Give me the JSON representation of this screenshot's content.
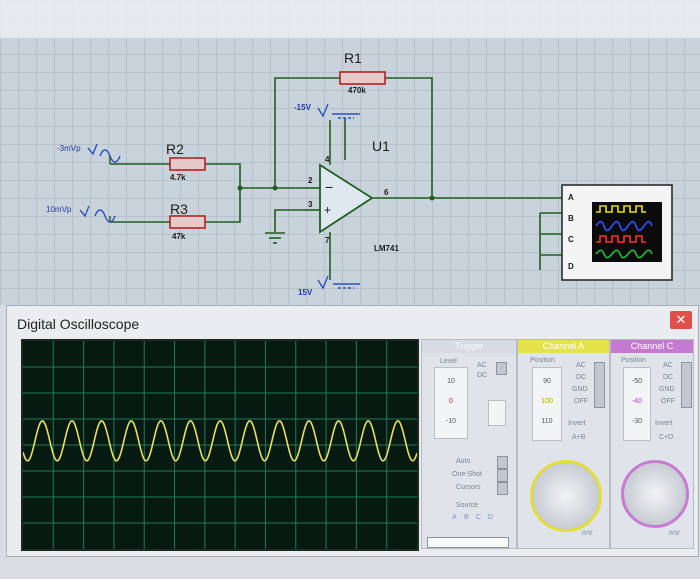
{
  "schematic": {
    "r1": {
      "name": "R1",
      "value": "470k"
    },
    "r2": {
      "name": "R2",
      "value": "4.7k"
    },
    "r3": {
      "name": "R3",
      "value": "47k"
    },
    "u1": {
      "name": "U1",
      "part": "LM741"
    },
    "sources": {
      "s1": "-3mVp",
      "s2": "10mVp"
    },
    "supplies": {
      "neg": "-15V",
      "pos": "15V"
    },
    "pins": {
      "p2": "2",
      "p3": "3",
      "p4": "4",
      "p6": "6",
      "p7": "7"
    },
    "scope_block": {
      "a": "A",
      "b": "B",
      "c": "C",
      "d": "D"
    },
    "colors": {
      "trace_a": "#e8e000",
      "trace_b": "#2f55ff",
      "trace_c": "#ff3030",
      "trace_d": "#22c33a",
      "wire": "#1f5e1f",
      "resistor": "#b62020"
    }
  },
  "scope": {
    "title": "Digital Oscilloscope",
    "close_icon": "close-icon",
    "trace_color": "#e8e060",
    "trigger": {
      "header": "Trigger",
      "level_label": "Level",
      "ticks": [
        "10",
        "0",
        "-10"
      ],
      "ac": "AC",
      "dc": "DC",
      "auto": "Auto",
      "one_shot": "One-Shot",
      "cursors": "Cursors",
      "source": "Source",
      "source_letters": [
        "A",
        "B",
        "C",
        "D"
      ]
    },
    "channel_a": {
      "header": "Channel A",
      "position_label": "Position",
      "ticks": [
        "90",
        "100",
        "110"
      ],
      "ac": "AC",
      "dc": "DC",
      "gnd": "GND",
      "off": "OFF",
      "invert": "Invert",
      "sum": "A+B",
      "knob_label": "mV"
    },
    "channel_c": {
      "header": "Channel C",
      "position_label": "Position",
      "ticks": [
        "-50",
        "-40",
        "-30"
      ],
      "ac": "AC",
      "dc": "DC",
      "gnd": "GND",
      "off": "OFF",
      "invert": "Invert",
      "sum": "C+D",
      "knob_label": "mV"
    }
  }
}
